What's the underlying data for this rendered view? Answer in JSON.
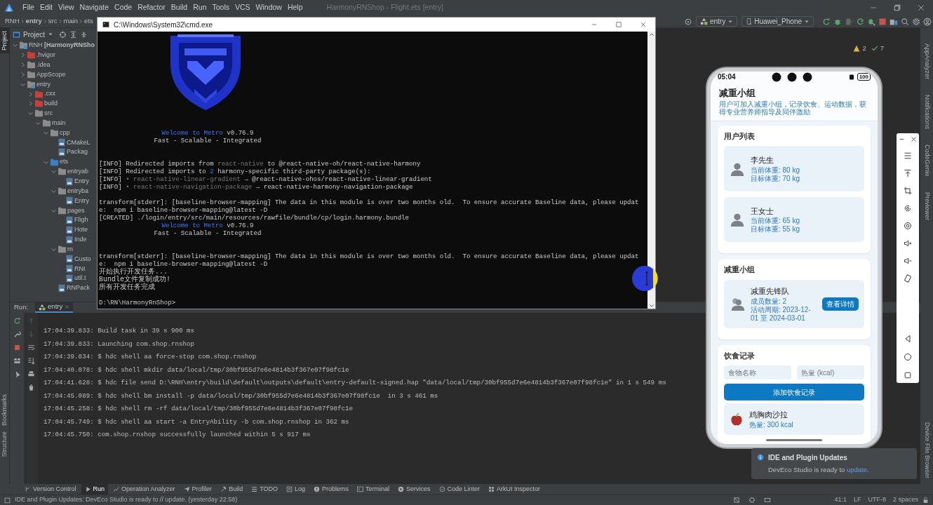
{
  "menu_bar": {
    "items": [
      "File",
      "Edit",
      "View",
      "Navigate",
      "Code",
      "Refactor",
      "Build",
      "Run",
      "Tools",
      "VCS",
      "Window",
      "Help"
    ],
    "title": "HarmonyRNShop - Flight.ets [entry]"
  },
  "breadcrumbs": [
    "RNH",
    "entry",
    "src",
    "main",
    "ets"
  ],
  "toolbar": {
    "run_config": "entry",
    "device": "Huawei_Phone"
  },
  "left_stripe": [
    {
      "label": "Project",
      "selected": true
    },
    {
      "label": "Bookmarks",
      "selected": false
    },
    {
      "label": "Structure",
      "selected": false
    }
  ],
  "project_panel": {
    "title": "Project",
    "tree": [
      {
        "label": "RNH **[HarmonyRNSho**",
        "kind": "module",
        "color": "#8c8c8c",
        "expanded": true,
        "children": [
          {
            "label": ".hvigor",
            "kind": "folder",
            "color": "#c9403a",
            "expanded": false
          },
          {
            "label": ".idea",
            "kind": "folder",
            "color": "#8c8c8c",
            "expanded": false
          },
          {
            "label": "AppScope",
            "kind": "folder",
            "color": "#8c8c8c",
            "expanded": false
          },
          {
            "label": "entry",
            "kind": "module",
            "color": "#8c8c8c",
            "expanded": true,
            "children": [
              {
                "label": ".cxx",
                "kind": "folder",
                "color": "#c9403a",
                "expanded": false
              },
              {
                "label": "build",
                "kind": "folder",
                "color": "#c9403a",
                "expanded": false
              },
              {
                "label": "src",
                "kind": "folder",
                "color": "#8c8c8c",
                "expanded": true,
                "children": [
                  {
                    "label": "main",
                    "kind": "folder",
                    "color": "#8c8c8c",
                    "expanded": true,
                    "children": [
                      {
                        "label": "cpp",
                        "kind": "folder",
                        "color": "#8c8c8c",
                        "expanded": true,
                        "children": [
                          {
                            "label": "CMakeL",
                            "kind": "file"
                          },
                          {
                            "label": "Packag",
                            "kind": "file"
                          }
                        ]
                      },
                      {
                        "label": "ets",
                        "kind": "folder",
                        "color": "#3d7fc4",
                        "expanded": true,
                        "children": [
                          {
                            "label": "entryab",
                            "kind": "folder",
                            "color": "#8c8c8c",
                            "expanded": true,
                            "children": [
                              {
                                "label": "Entry",
                                "kind": "file"
                              }
                            ]
                          },
                          {
                            "label": "entryba",
                            "kind": "folder",
                            "color": "#8c8c8c",
                            "expanded": true,
                            "children": [
                              {
                                "label": "Entry",
                                "kind": "file"
                              }
                            ]
                          },
                          {
                            "label": "pages",
                            "kind": "folder",
                            "color": "#8c8c8c",
                            "expanded": true,
                            "children": [
                              {
                                "label": "Fligh",
                                "kind": "file"
                              },
                              {
                                "label": "Hote",
                                "kind": "file"
                              },
                              {
                                "label": "Inde",
                                "kind": "file"
                              }
                            ]
                          },
                          {
                            "label": "rn",
                            "kind": "folder",
                            "color": "#8c8c8c",
                            "expanded": true,
                            "children": [
                              {
                                "label": "Custo",
                                "kind": "file"
                              },
                              {
                                "label": "RNI",
                                "kind": "file"
                              },
                              {
                                "label": "util.t",
                                "kind": "file"
                              }
                            ]
                          },
                          {
                            "label": "RNPack",
                            "kind": "file"
                          }
                        ]
                      }
                    ]
                  }
                ]
              }
            ]
          }
        ]
      }
    ]
  },
  "inspections": {
    "warnings": "2",
    "passed": "7"
  },
  "right_stripe": [
    "AppAnalyzer",
    "Notifications",
    "CodeGenie",
    "Previewer",
    "Device File Browser"
  ],
  "terminal_window": {
    "title": "C:\\Windows\\System32\\cmd.exe",
    "lines": [
      {
        "kind": "banner",
        "segments": [
          {
            "text": "Welcome to Metro",
            "kind": "accent"
          },
          {
            "text": " v0.76.9",
            "kind": "plain"
          }
        ]
      },
      {
        "kind": "banner",
        "segments": [
          {
            "text": "Fast - Scalable - Integrated",
            "kind": "plain"
          }
        ]
      },
      {
        "kind": "blank"
      },
      {
        "kind": "blank"
      },
      {
        "kind": "text",
        "segments": [
          {
            "text": "[INFO] Redirected imports from ",
            "kind": "plain"
          },
          {
            "text": "react-native",
            "kind": "muted"
          },
          {
            "text": " to @react-native-oh/react-native-harmony",
            "kind": "plain"
          }
        ]
      },
      {
        "kind": "text",
        "segments": [
          {
            "text": "[INFO] Redirected imports to ",
            "kind": "plain"
          },
          {
            "text": "2",
            "kind": "accent"
          },
          {
            "text": " harmony-specific third-party package(s):",
            "kind": "plain"
          }
        ]
      },
      {
        "kind": "text",
        "segments": [
          {
            "text": "[INFO] ",
            "kind": "plain"
          },
          {
            "text": "• react-native-linear-gradient",
            "kind": "muted"
          },
          {
            "text": " → @react-native-ohos/react-native-linear-gradient",
            "kind": "plain"
          }
        ]
      },
      {
        "kind": "text",
        "segments": [
          {
            "text": "[INFO] ",
            "kind": "plain"
          },
          {
            "text": "• react-native-navigation-package",
            "kind": "muted"
          },
          {
            "text": " → react-native-harmony-navigation-package",
            "kind": "plain"
          }
        ]
      },
      {
        "kind": "blank"
      },
      {
        "kind": "text",
        "segments": [
          {
            "text": "transform[stderr]: [baseline-browser-mapping] The data in this module is over two months old.  To ensure accurate Baseline data, please updat",
            "kind": "plain"
          }
        ]
      },
      {
        "kind": "text",
        "segments": [
          {
            "text": "e:  npm i baseline-browser-mapping@latest -D",
            "kind": "plain"
          }
        ]
      },
      {
        "kind": "text",
        "segments": [
          {
            "text": "[CREATED] ./login/entry/src/main/resources/rawfile/bundle/cp/login.harmony.bundle",
            "kind": "plain"
          }
        ]
      },
      {
        "kind": "banner",
        "segments": [
          {
            "text": "Welcome to Metro",
            "kind": "accent"
          },
          {
            "text": " v0.76.9",
            "kind": "plain"
          }
        ]
      },
      {
        "kind": "banner",
        "segments": [
          {
            "text": "Fast - Scalable - Integrated",
            "kind": "plain"
          }
        ]
      },
      {
        "kind": "blank"
      },
      {
        "kind": "blank"
      },
      {
        "kind": "text",
        "segments": [
          {
            "text": "transform[stderr]: [baseline-browser-mapping] The data in this module is over two months old.  To ensure accurate Baseline data, please updat",
            "kind": "plain"
          }
        ]
      },
      {
        "kind": "text",
        "segments": [
          {
            "text": "e:  npm i baseline-browser-mapping@latest -D",
            "kind": "plain"
          }
        ]
      },
      {
        "kind": "text",
        "segments": [
          {
            "text": "开始执行开发任务...",
            "kind": "plain"
          }
        ]
      },
      {
        "kind": "text",
        "segments": [
          {
            "text": "Bundle文件复制成功!",
            "kind": "plain"
          }
        ]
      },
      {
        "kind": "text",
        "segments": [
          {
            "text": "所有开发任务完成",
            "kind": "plain"
          }
        ]
      },
      {
        "kind": "blank"
      },
      {
        "kind": "text",
        "segments": [
          {
            "text": "D:\\RN\\HarmonyRnShop>",
            "kind": "plain"
          }
        ]
      }
    ]
  },
  "run_panel": {
    "label": "Run:",
    "tab": "entry",
    "log": [
      "17:04:39.833: Build task in 39 s 900 ms",
      "17:04:39.833: Launching com.shop.rnshop",
      "17:04:39.834: $ hdc shell aa force-stop com.shop.rnshop",
      "17:04:40.078: $ hdc shell mkdir data/local/tmp/30bf955d7e6e4814b3f367e07f98fc1e",
      "17:04:41.628: $ hdc file send D:\\RNH\\entry\\build\\default\\outputs\\default\\entry-default-signed.hap \"data/local/tmp/30bf955d7e6e4814b3f367e07f98fc1e\" in 1 s 549 ms",
      "17:04:45.089: $ hdc shell bm install -p data/local/tmp/30bf955d7e6e4814b3f367e07f98fc1e  in 3 s 461 ms",
      "17:04:45.258: $ hdc shell rm -rf data/local/tmp/30bf955d7e6e4814b3f367e07f98fc1e",
      "17:04:45.749: $ hdc shell aa start -a EntryAbility -b com.shop.rnshop in 362 ms",
      "17:04:45.750: com.shop.rnshop successfully launched within 5 s 917 ms"
    ]
  },
  "tool_windows": [
    {
      "label": "Version Control",
      "selected": false
    },
    {
      "label": "Run",
      "selected": true
    },
    {
      "label": "Operation Analyzer",
      "selected": false
    },
    {
      "label": "Profiler",
      "selected": false
    },
    {
      "label": "Build",
      "selected": false
    },
    {
      "label": "TODO",
      "selected": false
    },
    {
      "label": "Log",
      "selected": false
    },
    {
      "label": "Problems",
      "selected": false
    },
    {
      "label": "Terminal",
      "selected": false
    },
    {
      "label": "Services",
      "selected": false
    },
    {
      "label": "Code Linter",
      "selected": false
    },
    {
      "label": "ArkUI Inspector",
      "selected": false
    }
  ],
  "status_bar": {
    "message": "IDE and Plugin Updates: DevEco Studio is ready to // update. (yesterday 22:58)",
    "position": "41:1",
    "line_ending": "LF",
    "encoding": "UTF-8",
    "indent": "2 spaces"
  },
  "phone": {
    "time": "05:04",
    "battery": "100",
    "title": "减重小组",
    "subtitle": "用户可加入减重小组，记录饮食、运动数据，获得专业营养师指导及同伴激励",
    "sections": [
      {
        "kind": "users",
        "title": "用户列表",
        "items": [
          {
            "name": "李先生",
            "lines": [
              "当前体重: 80 kg",
              "目标体重: 70 kg"
            ]
          },
          {
            "name": "王女士",
            "lines": [
              "当前体重: 65 kg",
              "目标体重: 55 kg"
            ]
          }
        ]
      },
      {
        "kind": "groups",
        "title": "减重小组",
        "items": [
          {
            "name": "减重先锋队",
            "lines": [
              "成员数量: 2",
              "活动周期: 2023-12-01 至 2024-03-01"
            ],
            "action": "查看详情"
          }
        ]
      },
      {
        "kind": "diet",
        "title": "饮食记录",
        "fields": [
          {
            "placeholder": "食物名称"
          },
          {
            "placeholder": "热量 (kcal)"
          }
        ],
        "button": "添加饮食记录",
        "items": [
          {
            "name": "鸡胸肉沙拉",
            "lines": [
              "热量: 300 kcal"
            ]
          }
        ]
      }
    ]
  },
  "notification": {
    "title": "IDE and Plugin Updates",
    "text": "DevEco Studio is ready to ",
    "link": "update",
    "end": "."
  }
}
